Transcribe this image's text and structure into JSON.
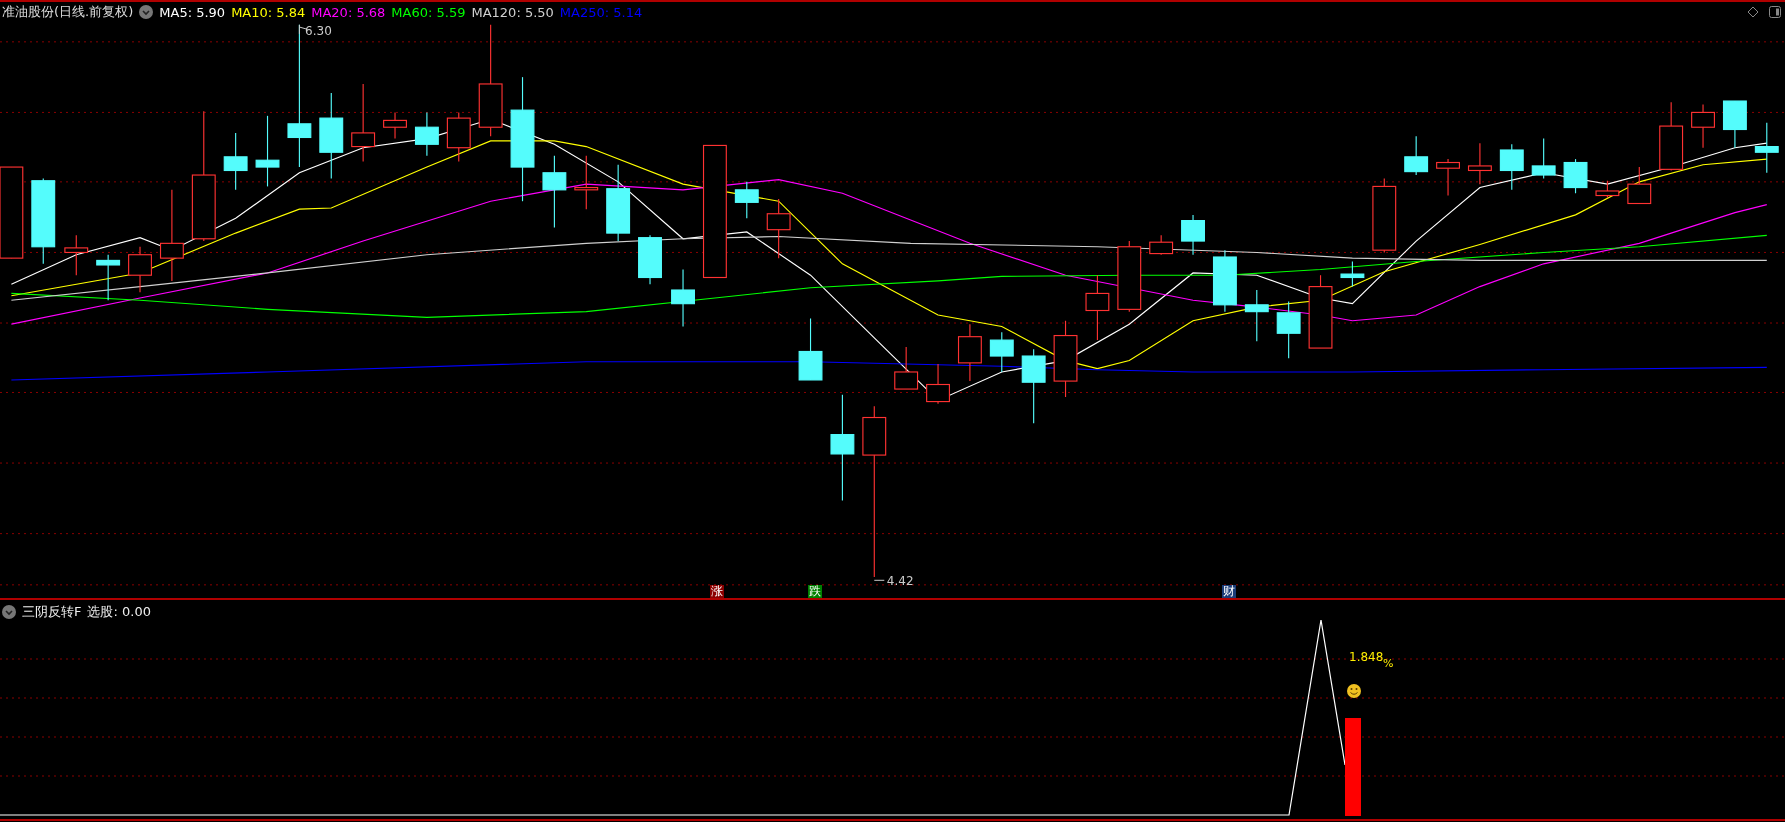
{
  "header": {
    "title": "准油股份(日线.前复权)",
    "indicators": [
      {
        "label": "MA5: 5.90",
        "color": "#ffffff"
      },
      {
        "label": "MA10: 5.84",
        "color": "#ffff00"
      },
      {
        "label": "MA20: 5.68",
        "color": "#ff00ff"
      },
      {
        "label": "MA60: 5.59",
        "color": "#00ff00"
      },
      {
        "label": "MA120: 5.50",
        "color": "#d0d0d0"
      },
      {
        "label": "MA250: 5.14",
        "color": "#0000ff"
      }
    ]
  },
  "price_labels": {
    "high": "6.30",
    "low": "4.42"
  },
  "event_markers": [
    {
      "label": "涨",
      "color": "#8b0000"
    },
    {
      "label": "跌",
      "color": "#008000"
    },
    {
      "label": "财",
      "color": "#1a3c78"
    }
  ],
  "sub_panel": {
    "title": "三阴反转F",
    "reading": "选股: 0.00",
    "value": "1.848",
    "unit": "%"
  }
}
